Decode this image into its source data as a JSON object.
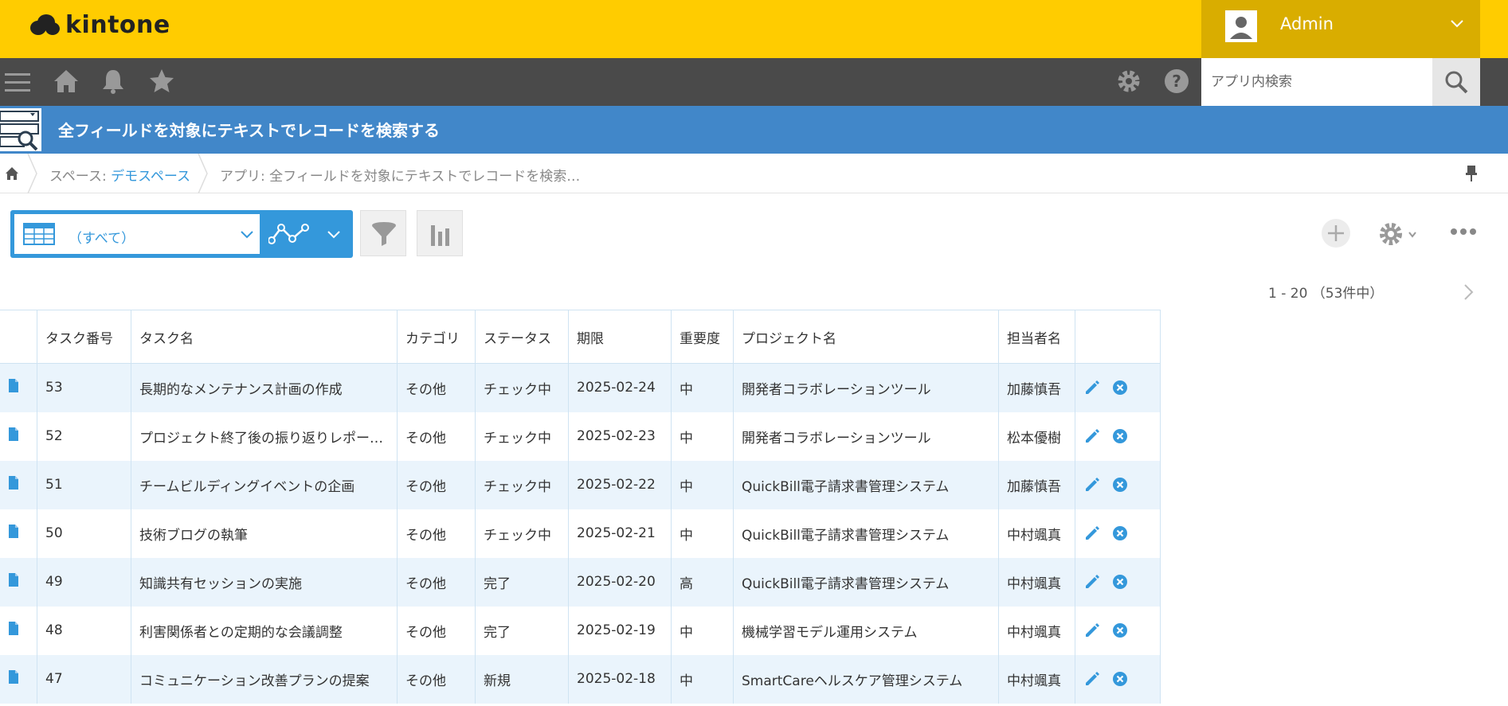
{
  "header": {
    "logo_text": "kintone",
    "user_name": "Admin"
  },
  "nav": {
    "search_placeholder": "アプリ内検索"
  },
  "app": {
    "title": "全フィールドを対象にテキストでレコードを検索する"
  },
  "breadcrumb": {
    "space_prefix": "スペース: ",
    "space_name": "デモスペース",
    "app_crumb": "アプリ: 全フィールドを対象にテキストでレコードを検索…"
  },
  "toolbar": {
    "view_label": "（すべて）"
  },
  "pagination": {
    "text": "1 - 20 （53件中）"
  },
  "table": {
    "columns": [
      "タスク番号",
      "タスク名",
      "カテゴリ",
      "ステータス",
      "期限",
      "重要度",
      "プロジェクト名",
      "担当者名"
    ],
    "rows": [
      [
        "53",
        "長期的なメンテナンス計画の作成",
        "その他",
        "チェック中",
        "2025-02-24",
        "中",
        "開発者コラボレーションツール",
        "加藤慎吾"
      ],
      [
        "52",
        "プロジェクト終了後の振り返りレポー…",
        "その他",
        "チェック中",
        "2025-02-23",
        "中",
        "開発者コラボレーションツール",
        "松本優樹"
      ],
      [
        "51",
        "チームビルディングイベントの企画",
        "その他",
        "チェック中",
        "2025-02-22",
        "中",
        "QuickBill電子請求書管理システム",
        "加藤慎吾"
      ],
      [
        "50",
        "技術ブログの執筆",
        "その他",
        "チェック中",
        "2025-02-21",
        "中",
        "QuickBill電子請求書管理システム",
        "中村颯真"
      ],
      [
        "49",
        "知識共有セッションの実施",
        "その他",
        "完了",
        "2025-02-20",
        "高",
        "QuickBill電子請求書管理システム",
        "中村颯真"
      ],
      [
        "48",
        "利害関係者との定期的な会議調整",
        "その他",
        "完了",
        "2025-02-19",
        "中",
        "機械学習モデル運用システム",
        "中村颯真"
      ],
      [
        "47",
        "コミュニケーション改善プランの提案",
        "その他",
        "新規",
        "2025-02-18",
        "中",
        "SmartCareヘルスケア管理システム",
        "中村颯真"
      ]
    ]
  },
  "colors": {
    "header_yellow": "#ffcc00",
    "nav_dark": "#4a4a4a",
    "title_blue": "#4187c9",
    "accent_blue": "#3498db",
    "row_alt": "#eaf4fc"
  }
}
